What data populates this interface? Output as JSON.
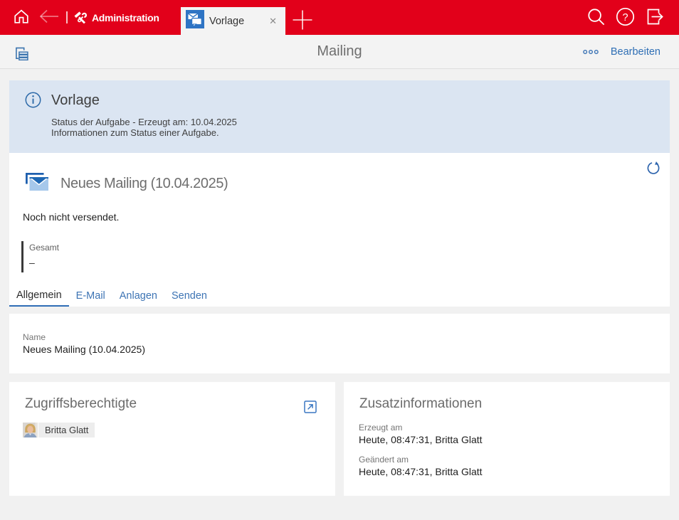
{
  "topbar": {
    "app_label": "Administration",
    "tab": {
      "label": "Vorlage",
      "close": "✕"
    }
  },
  "toolbar": {
    "title": "Mailing",
    "edit_label": "Bearbeiten"
  },
  "banner": {
    "title": "Vorlage",
    "line1": "Status der Aufgabe - Erzeugt am: 10.04.2025",
    "line2": "Informationen zum Status einer Aufgabe."
  },
  "record": {
    "title": "Neues Mailing (10.04.2025)",
    "status": "Noch nicht versendet.",
    "stat": {
      "label": "Gesamt",
      "value": "–"
    }
  },
  "tabs": [
    {
      "label": "Allgemein"
    },
    {
      "label": "E-Mail"
    },
    {
      "label": "Anlagen"
    },
    {
      "label": "Senden"
    }
  ],
  "name_card": {
    "label": "Name",
    "value": "Neues Mailing (10.04.2025)"
  },
  "access_card": {
    "title": "Zugriffsberechtigte",
    "person": "Britta Glatt"
  },
  "info_card": {
    "title": "Zusatzinformationen",
    "fields": [
      {
        "label": "Erzeugt am",
        "value": "Heute, 08:47:31, Britta Glatt"
      },
      {
        "label": "Geändert am",
        "value": "Heute, 08:47:31, Britta Glatt"
      }
    ]
  },
  "colors": {
    "brand_red": "#e2001a",
    "accent_blue": "#2f6fb5",
    "banner_blue": "#dbe5f2"
  }
}
